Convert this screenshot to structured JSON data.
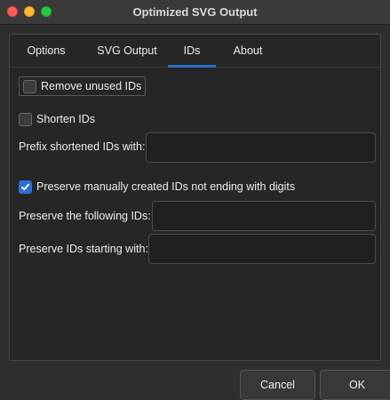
{
  "window": {
    "title": "Optimized SVG Output"
  },
  "tabs": [
    {
      "label": "Options",
      "active": false
    },
    {
      "label": "SVG Output",
      "active": false
    },
    {
      "label": "IDs",
      "active": true
    },
    {
      "label": "About",
      "active": false
    }
  ],
  "ids": {
    "remove_unused": {
      "label": "Remove unused IDs",
      "checked": false
    },
    "shorten": {
      "label": "Shorten IDs",
      "checked": false
    },
    "prefix": {
      "label": "Prefix shortened IDs with:",
      "value": ""
    },
    "preserve_manual": {
      "label": "Preserve manually created IDs not ending with digits",
      "checked": true
    },
    "preserve_following": {
      "label": "Preserve the following IDs:",
      "value": ""
    },
    "preserve_starting": {
      "label": "Preserve IDs starting with:",
      "value": ""
    }
  },
  "footer": {
    "cancel_label": "Cancel",
    "ok_label": "OK"
  },
  "colors": {
    "accent": "#2a71d6",
    "close": "#fe5f57",
    "minimize": "#febc2e",
    "maximize": "#28c840"
  }
}
